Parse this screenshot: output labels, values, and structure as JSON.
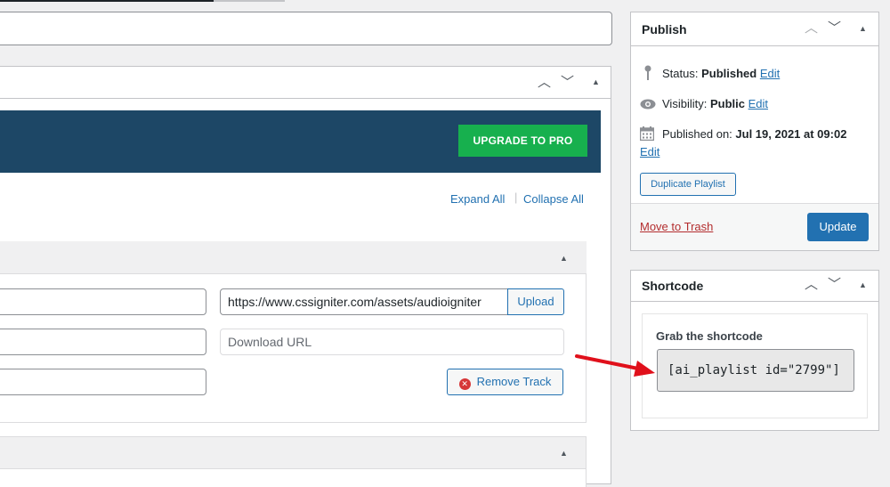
{
  "accent_colors": {
    "banner": "#1d4766",
    "upgrade": "#17b04e",
    "link": "#2271b1",
    "trash": "#b32d2e",
    "arrow": "#e0101b"
  },
  "banner": {
    "upgrade_label": "UPGRADE TO PRO"
  },
  "tracks": {
    "expand_all": "Expand All",
    "collapse_all": "Collapse All",
    "track1": {
      "url_value": "https://www.cssigniter.com/assets/audioigniter",
      "upload_label": "Upload",
      "download_placeholder": "Download URL",
      "remove_label": "Remove Track"
    }
  },
  "publish": {
    "title": "Publish",
    "status_label": "Status:",
    "status_value": "Published",
    "visibility_label": "Visibility:",
    "visibility_value": "Public",
    "published_on_label": "Published on:",
    "published_on_value": "Jul 19, 2021 at 09:02",
    "edit_label": "Edit",
    "duplicate_label": "Duplicate Playlist",
    "trash_label": "Move to Trash",
    "update_label": "Update"
  },
  "shortcode": {
    "title": "Shortcode",
    "grab_label": "Grab the shortcode",
    "code": "[ai_playlist id=\"2799\"]"
  },
  "icons": [
    "chevron-up-icon",
    "chevron-down-icon",
    "triangle-up-icon",
    "pin-icon",
    "eye-icon",
    "calendar-icon",
    "remove-circle-icon",
    "red-arrow"
  ]
}
